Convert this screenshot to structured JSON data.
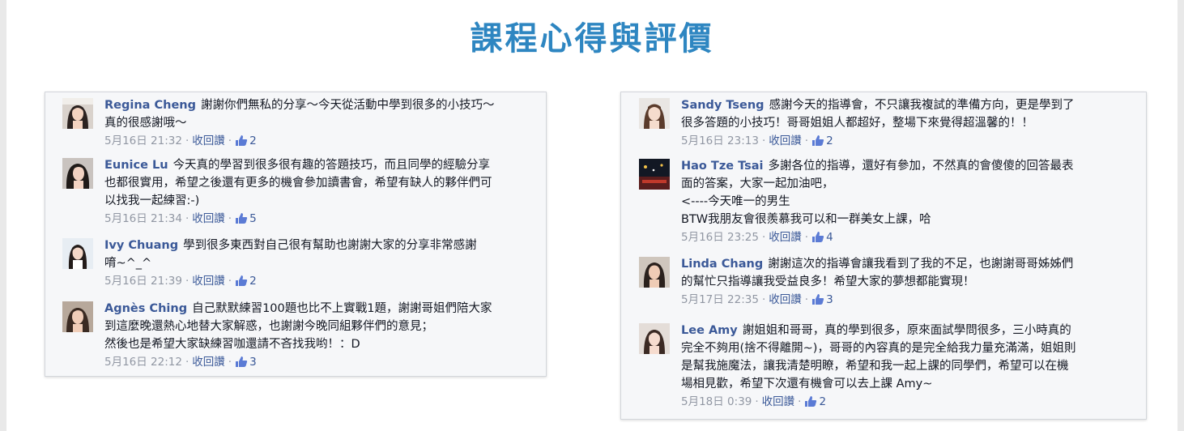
{
  "page": {
    "title": "課程心得與評價"
  },
  "colors": {
    "title": "#2e86c1",
    "author": "#3b5998",
    "meta": "#9197a3",
    "panel_bg": "#f6f7f9"
  },
  "left_comments": [
    {
      "author": "Regina Cheng",
      "text": "謝謝你們無私的分享～今天從活動中學到很多的小技巧～\n真的很感謝哦～",
      "date": "5月16日 21:32",
      "action": "收回讚",
      "likes": "2",
      "icon": "thumbs-up-icon"
    },
    {
      "author": "Eunice Lu",
      "text": "今天真的學習到很多很有趣的答題技巧，而且同學的經驗分享\n也都很實用，希望之後還有更多的機會參加讀書會，希望有缺人的夥伴們可\n以找我一起練習:-)",
      "date": "5月16日 21:34",
      "action": "收回讚",
      "likes": "5",
      "icon": "thumbs-up-icon"
    },
    {
      "author": "Ivy Chuang",
      "text": "學到很多東西對自己很有幫助也謝謝大家的分享非常感謝\n唷~^_^",
      "date": "5月16日 21:39",
      "action": "收回讚",
      "likes": "2",
      "icon": "thumbs-up-icon"
    },
    {
      "author": "Agnès Ching",
      "text": "自己默默練習100題也比不上實戰1題，謝謝哥姐們陪大家\n到這麼晚還熱心地替大家解惑，也謝謝今晚同組夥伴們的意見；\n然後也是希望大家缺練習咖還請不吝找我哟！：D",
      "date": "5月16日 22:12",
      "action": "收回讚",
      "likes": "3",
      "icon": "thumbs-up-icon"
    }
  ],
  "right_comments": [
    {
      "author": "Sandy Tseng",
      "text": "感謝今天的指導會，不只讓我複試的準備方向，更是學到了\n很多答題的小技巧！哥哥姐姐人都超好，整場下來覺得超溫馨的！！",
      "date": "5月16日 23:13",
      "action": "收回讚",
      "likes": "2",
      "icon": "thumbs-up-icon"
    },
    {
      "author": "Hao Tze Tsai",
      "text": "多謝各位的指導，還好有參加，不然真的會傻傻的回答最表\n面的答案，大家一起加油吧，\n<----今天唯一的男生\nBTW我朋友會很羨慕我可以和一群美女上課，哈",
      "date": "5月16日 23:25",
      "action": "收回讚",
      "likes": "4",
      "icon": "thumbs-up-icon"
    },
    {
      "author": "Linda Chang",
      "text": "謝謝這次的指導會讓我看到了我的不足，也謝謝哥哥姊姊們\n的幫忙只指導讓我受益良多！希望大家的夢想都能實現！",
      "date": "5月17日 22:35",
      "action": "收回讚",
      "likes": "3",
      "icon": "thumbs-up-icon"
    },
    {
      "author": "Lee Amy",
      "text": "謝姐姐和哥哥，真的學到很多，原來面試學問很多，三小時真的\n完全不夠用(捨不得離開~)，哥哥的內容真的是完全給我力量充滿滿，姐姐則\n是幫我施魔法，讓我清楚明瞭，希望和我一起上課的同學們，希望可以在機\n場相見歡，希望下次還有機會可以去上課 Amy~",
      "date": "5月18日 0:39",
      "action": "收回讚",
      "likes": "2",
      "icon": "thumbs-up-icon"
    }
  ]
}
